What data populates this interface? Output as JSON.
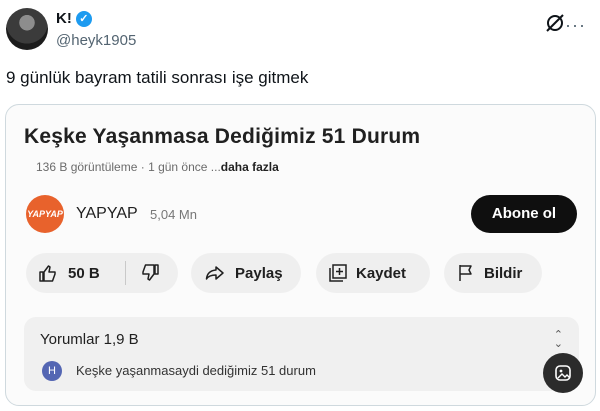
{
  "tweet": {
    "display_name": "K!",
    "handle": "@heyk1905",
    "text": "9 günlük bayram tatili sonrası işe gitmek",
    "verified_glyph": "✓"
  },
  "media": {
    "video_title": "Keşke Yaşanmasa Dediğimiz 51 Durum",
    "meta": "136 B görüntüleme · 1 gün önce ...",
    "meta_more": "daha fazla",
    "channel": {
      "logo_text": "YAPYAP",
      "name": "YAPYAP",
      "subscribers": "5,04 Mn"
    },
    "subscribe_label": "Abone ol",
    "actions": {
      "likes": "50 B",
      "share": "Paylaş",
      "save": "Kaydet",
      "report": "Bildir"
    },
    "comments": {
      "title": "Yorumlar 1,9 B",
      "avatar_letter": "H",
      "first_comment": "Keşke yaşanmasaydi dediğimiz 51 durum"
    }
  },
  "colors": {
    "accent": "#1d9bf0",
    "subscribe_bg": "#0f0f0f",
    "channel_brand": "#e8622c"
  },
  "icons": [
    "grok-icon",
    "more-icon",
    "thumbs-up-icon",
    "thumbs-down-icon",
    "share-icon",
    "save-playlist-icon",
    "flag-icon",
    "expand-icon",
    "alt-text-icon"
  ]
}
